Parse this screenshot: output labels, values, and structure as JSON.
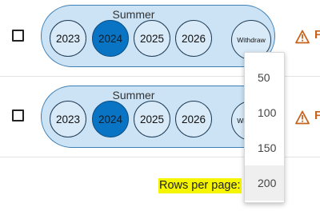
{
  "rows": [
    {
      "term": "Summer",
      "years": [
        "2023",
        "2024",
        "2025",
        "2026"
      ],
      "selected_year": "2024",
      "withdraw_label": "Withdraw",
      "alert_letter": "F"
    },
    {
      "term": "Summer",
      "years": [
        "2023",
        "2024",
        "2025",
        "2026"
      ],
      "selected_year": "2024",
      "withdraw_label": "Withdraw",
      "alert_letter": "F"
    }
  ],
  "pagination": {
    "rows_per_page_label": "Rows per page:",
    "options": [
      "50",
      "100",
      "150",
      "200"
    ],
    "highlighted_option": "200"
  },
  "colors": {
    "pill_fill": "#cce3f5",
    "selected_year": "#0a74c4",
    "warning": "#c8621b",
    "label_highlight": "#f5f500"
  },
  "icons": {
    "checkbox": "checkbox-icon",
    "warning": "warning-triangle-icon"
  }
}
